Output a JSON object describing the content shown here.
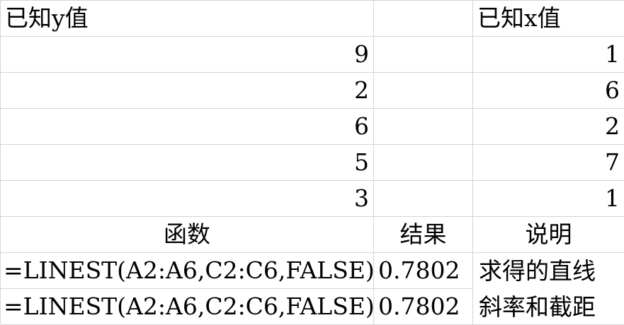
{
  "sheet": {
    "header_y": "已知y值",
    "header_blank": "",
    "header_x": "已知x值",
    "rows": [
      {
        "y": "9",
        "x": "1"
      },
      {
        "y": "2",
        "x": "6"
      },
      {
        "y": "6",
        "x": "2"
      },
      {
        "y": "5",
        "x": "7"
      },
      {
        "y": "3",
        "x": "1"
      }
    ],
    "col_function": "函数",
    "col_result": "结果",
    "col_desc": "说明",
    "formulas": [
      {
        "formula": "=LINEST(A2:A6,C2:C6,FALSE)",
        "result": "0.7802"
      },
      {
        "formula": "=LINEST(A2:A6,C2:C6,FALSE)",
        "result": "0.7802"
      }
    ],
    "description_lines": [
      "求得的直线",
      "斜率和截距"
    ]
  }
}
